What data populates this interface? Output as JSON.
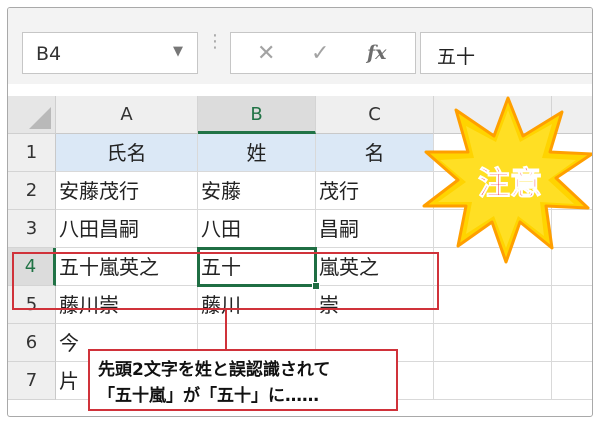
{
  "formula_bar": {
    "name_box": "B4",
    "cancel_icon": "✕",
    "enter_icon": "✓",
    "fx_label": "fx",
    "formula_value": "五十"
  },
  "columns": [
    "A",
    "B",
    "C"
  ],
  "selected_column": "B",
  "rows": [
    {
      "num": "1",
      "cells": [
        "氏名",
        "姓",
        "名"
      ]
    },
    {
      "num": "2",
      "cells": [
        "安藤茂行",
        "安藤",
        "茂行"
      ]
    },
    {
      "num": "3",
      "cells": [
        "八田昌嗣",
        "八田",
        "昌嗣"
      ]
    },
    {
      "num": "4",
      "cells": [
        "五十嵐英之",
        "五十",
        "嵐英之"
      ]
    },
    {
      "num": "5",
      "cells": [
        "藤川崇",
        "藤川",
        "崇"
      ]
    },
    {
      "num": "6",
      "cells": [
        "今",
        "",
        ""
      ]
    },
    {
      "num": "7",
      "cells": [
        "片",
        "",
        ""
      ]
    }
  ],
  "active_cell": "B4",
  "callout": {
    "line1": "先頭2文字を姓と誤認識されて",
    "line2": "「五十嵐」が「五十」に……"
  },
  "badge": {
    "text": "注意",
    "colors": {
      "fill": "#ffd400",
      "edge": "#ff9f00",
      "text": "#e60012"
    }
  },
  "colors": {
    "accent": "#217346",
    "highlight": "#d0323a",
    "header_row_fill": "#dbe8f6"
  }
}
